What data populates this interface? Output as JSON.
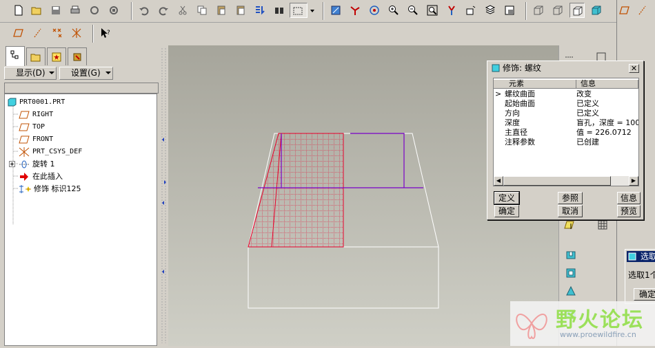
{
  "navigator": {
    "menu_show": "显示(D)",
    "menu_settings": "设置(G)",
    "tree": [
      {
        "label": "PRT0001.PRT",
        "icon": "part-icon"
      },
      {
        "label": "RIGHT",
        "icon": "datum-plane-icon"
      },
      {
        "label": "TOP",
        "icon": "datum-plane-icon"
      },
      {
        "label": "FRONT",
        "icon": "datum-plane-icon"
      },
      {
        "label": "PRT_CSYS_DEF",
        "icon": "coordinate-system-icon"
      },
      {
        "label": "旋转 1",
        "icon": "revolve-icon"
      },
      {
        "label": "在此插入",
        "icon": "insert-here-arrow-icon"
      },
      {
        "label": "修饰 标识125",
        "icon": "cosmetic-thread-icon"
      }
    ]
  },
  "dialog": {
    "title": "修饰: 螺纹",
    "close": "✕",
    "columns": [
      "元素",
      "信息"
    ],
    "rows": [
      {
        "element": "螺纹曲面",
        "info": "改变",
        "current": true
      },
      {
        "element": "起始曲面",
        "info": "已定义"
      },
      {
        "element": "方向",
        "info": "已定义"
      },
      {
        "element": "深度",
        "info": "盲孔，深度 = 100"
      },
      {
        "element": "主直径",
        "info": "值 = 226.0712"
      },
      {
        "element": "注释参数",
        "info": "已创建"
      }
    ],
    "current_marker": ">",
    "buttons": {
      "define": "定义",
      "refs": "参照",
      "info": "信息",
      "ok": "确定",
      "cancel": "取消",
      "preview": "预览"
    }
  },
  "select_dialog": {
    "title": "选取",
    "text": "选取1个",
    "ok": "确定"
  },
  "watermark": {
    "title": "野火论坛",
    "url": "www.proewildfire.cn"
  },
  "colors": {
    "viewport_top": "#a6a59b",
    "viewport_bottom": "#cfcfc6",
    "preview_red": "#e8002a",
    "edge_purple": "#7a00c8",
    "title_blue": "#0a246a"
  }
}
